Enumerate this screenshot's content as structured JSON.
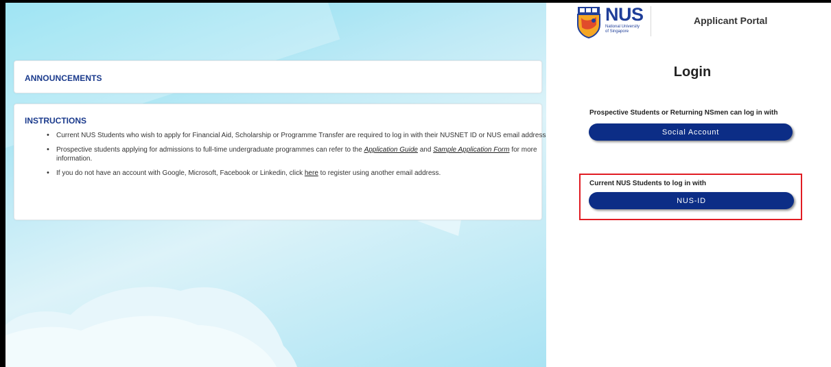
{
  "announcements": {
    "title": "ANNOUNCEMENTS"
  },
  "instructions": {
    "title": "INSTRUCTIONS",
    "item1": "Current NUS Students who wish to apply for Financial Aid, Scholarship or Programme Transfer are required to log in with their NUSNET ID or NUS email address.",
    "item2_prefix": "Prospective students applying for admissions to full-time undergraduate programmes can refer to the ",
    "item2_link1": "Application Guide",
    "item2_mid": " and ",
    "item2_link2": "Sample Application Form",
    "item2_suffix": " for more information.",
    "item3_prefix": "If you do not have an account with Google, Microsoft, Facebook or Linkedin, click ",
    "item3_link": "here",
    "item3_suffix": " to register using another email address."
  },
  "header": {
    "logo_text": "NUS",
    "logo_sub_line1": "National University",
    "logo_sub_line2": "of Singapore",
    "portal_title": "Applicant Portal"
  },
  "login": {
    "title": "Login",
    "prospective_prompt": "Prospective Students or Returning NSmen can log in with",
    "social_button": "Social Account",
    "current_prompt": "Current NUS Students to log in with",
    "nusid_button": "NUS-ID"
  },
  "colors": {
    "brand_blue": "#0c2d86",
    "heading_blue": "#1a3a8c",
    "highlight_red": "#e11b22"
  }
}
